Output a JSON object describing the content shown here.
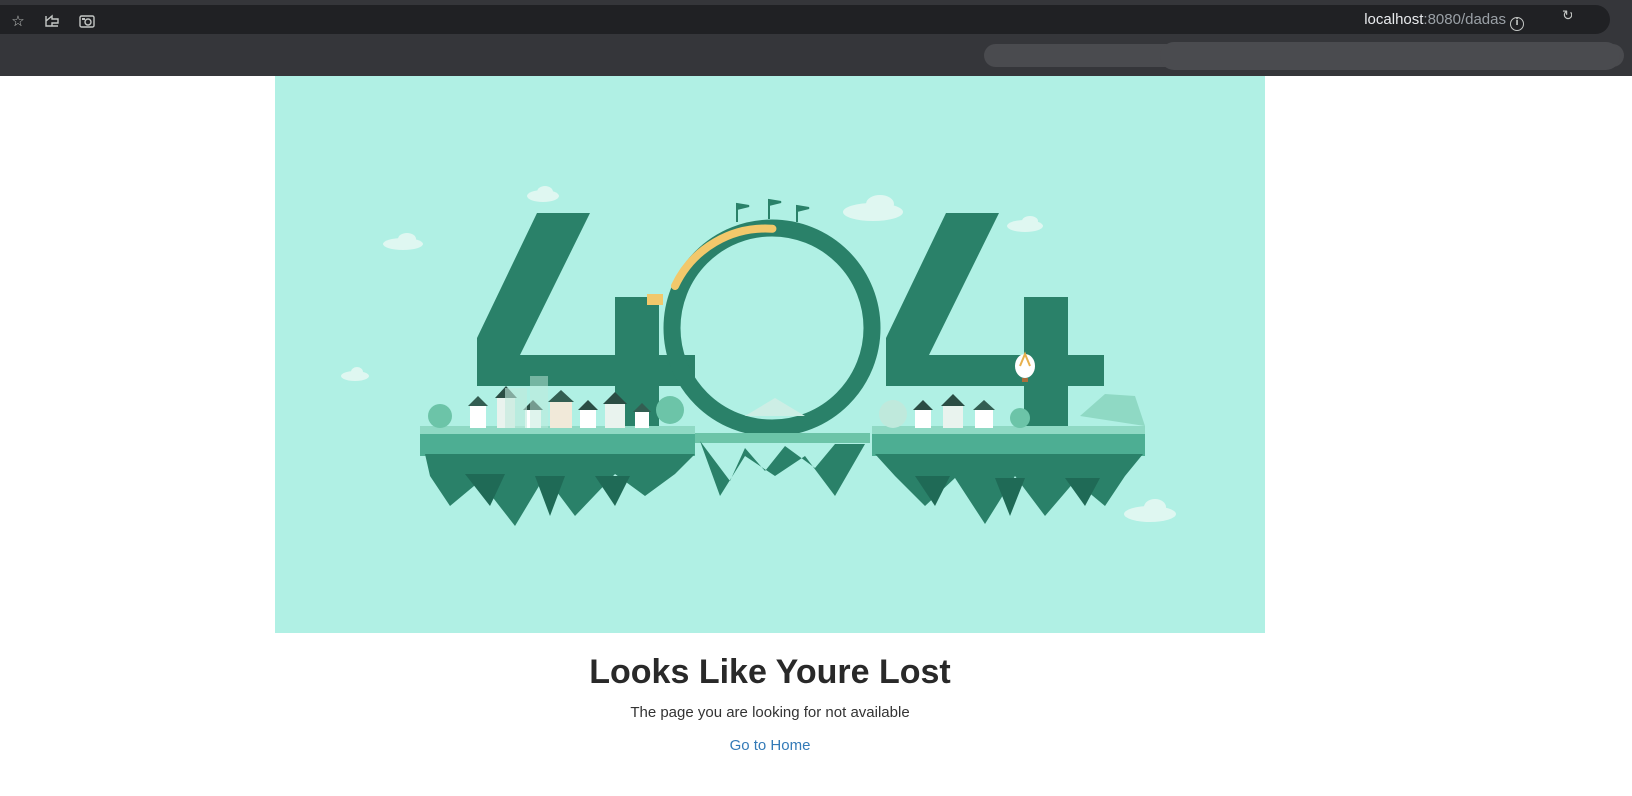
{
  "browser": {
    "url_host": "localhost",
    "url_path": ":8080/dadas",
    "icons": [
      "star-icon",
      "send-tab-icon",
      "screenshot-icon",
      "info-icon"
    ]
  },
  "hero": {
    "illustration": "404 floating islands illustration",
    "background_color": "#b0f0e4",
    "digit_color": "#2a8169"
  },
  "main": {
    "title": "Looks Like Youre Lost",
    "subtitle": "The page you are looking for not available",
    "home_link": "Go to Home",
    "link_color": "#337ab7"
  }
}
